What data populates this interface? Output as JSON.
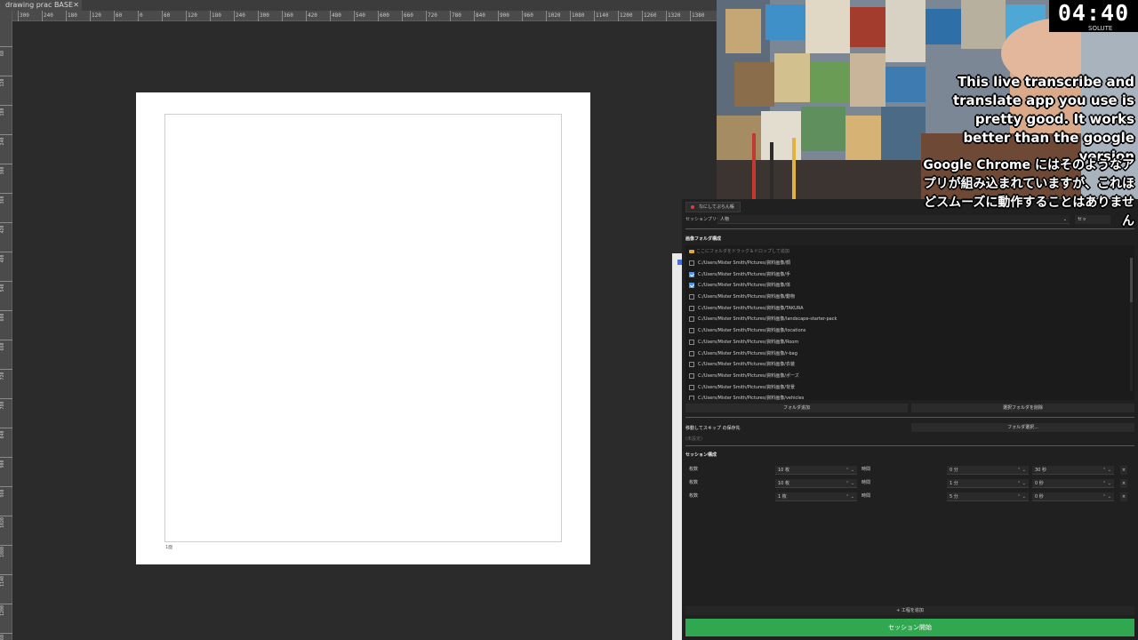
{
  "app": {
    "document_tab": "drawing prac BASE",
    "ruler_h": [
      "300",
      "240",
      "180",
      "120",
      "60",
      "0",
      "60",
      "120",
      "180",
      "240",
      "300",
      "360",
      "420",
      "480",
      "540",
      "600",
      "660",
      "720",
      "780",
      "840",
      "900",
      "960",
      "1020",
      "1080",
      "1140",
      "1200",
      "1260",
      "1320",
      "1380"
    ],
    "ruler_v": [
      "60",
      "120",
      "180",
      "240",
      "300",
      "360",
      "420",
      "480",
      "540",
      "600",
      "660",
      "720",
      "780",
      "840",
      "900",
      "960",
      "1020",
      "1080",
      "1140",
      "1200",
      "1260"
    ],
    "frame_label": "1面"
  },
  "stream": {
    "timer": "04:40",
    "timer_sub": "SOLUTE",
    "caption_en": "This live transcribe and translate app you use is pretty good. It works better than the google version",
    "caption_ja": "Google Chrome にはそのようなアプリが組み込まれていますが、これほどスムーズに動作することはありません"
  },
  "panel": {
    "tab_label": "なにしてぷらん帳",
    "preset_label": "セッションプリセット",
    "preset_value": "人物",
    "preset_button": "セッ",
    "image_folder_title": "画像フォルダ構成",
    "drop_hint": "ここにフォルダをドラッグ＆ドロップして追加",
    "folders": [
      {
        "path": "C:/Users/Mister Smith/Pictures/資料画像/顔",
        "checked": false
      },
      {
        "path": "C:/Users/Mister Smith/Pictures/資料画像/手",
        "checked": true
      },
      {
        "path": "C:/Users/Mister Smith/Pictures/資料画像/体",
        "checked": true
      },
      {
        "path": "C:/Users/Mister Smith/Pictures/資料画像/動物",
        "checked": false
      },
      {
        "path": "C:/Users/Mister Smith/Pictures/資料画像/TAKURA",
        "checked": false
      },
      {
        "path": "C:/Users/Mister Smith/Pictures/資料画像/landscape-starter-pack",
        "checked": false
      },
      {
        "path": "C:/Users/Mister Smith/Pictures/資料画像/locations",
        "checked": false
      },
      {
        "path": "C:/Users/Mister Smith/Pictures/資料画像/Room",
        "checked": false
      },
      {
        "path": "C:/Users/Mister Smith/Pictures/資料画像/r-bag",
        "checked": false
      },
      {
        "path": "C:/Users/Mister Smith/Pictures/資料画像/衣装",
        "checked": false
      },
      {
        "path": "C:/Users/Mister Smith/Pictures/資料画像/ポーズ",
        "checked": false
      },
      {
        "path": "C:/Users/Mister Smith/Pictures/資料画像/背景",
        "checked": false
      },
      {
        "path": "C:/Users/Mister Smith/Pictures/資料画像/vehicles",
        "checked": false
      }
    ],
    "add_folder_button": "フォルダ追加",
    "remove_folder_button": "選択フォルダを削除",
    "skip_label": "移動してスキップ の保存先",
    "skip_placeholder": "(未設定)",
    "select_folder_button": "フォルダ選択...",
    "session_title": "セッション構成",
    "session_rows": [
      {
        "label": "枚数",
        "count": "10 枚",
        "time_label": "時間",
        "minutes": "0 分",
        "seconds": "30 秒"
      },
      {
        "label": "枚数",
        "count": "10 枚",
        "time_label": "時間",
        "minutes": "1 分",
        "seconds": "0 秒"
      },
      {
        "label": "枚数",
        "count": "1 枚",
        "time_label": "時間",
        "minutes": "5 分",
        "seconds": "0 秒"
      }
    ],
    "remove_row_label": "×",
    "add_step_button": "+ 工程を追加",
    "start_button": "セッション開始"
  },
  "colors": {
    "start_green": "#2fa84f",
    "checkbox_blue": "#4a97e6",
    "panel_bg": "#202020",
    "workspace_bg": "#2b2b2b"
  }
}
